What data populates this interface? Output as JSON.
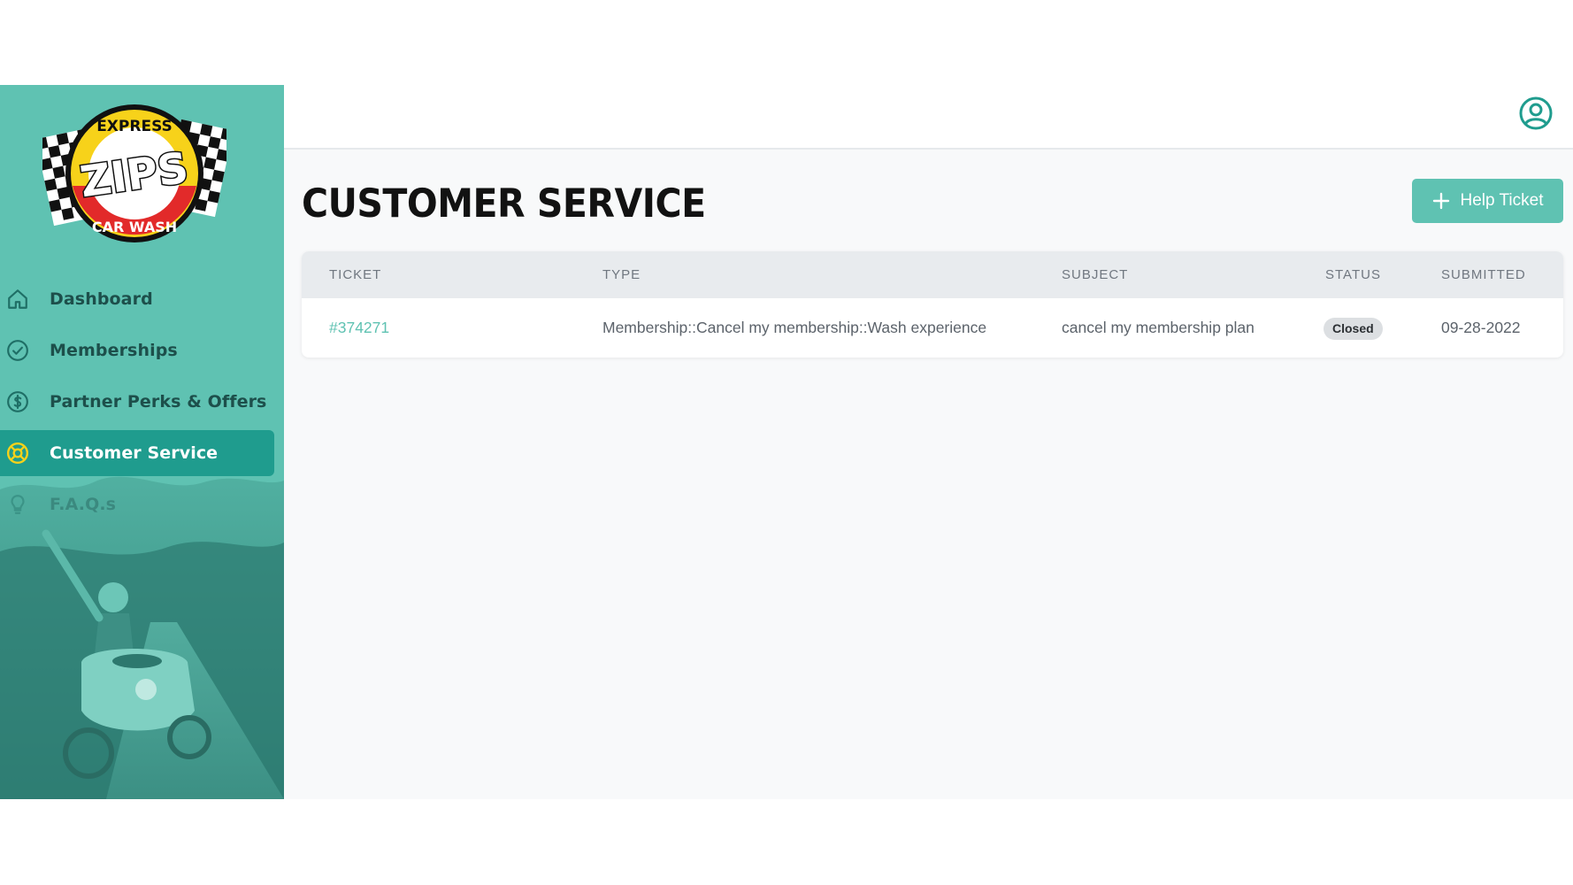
{
  "brand": {
    "logo_alt": "Zips Express Car Wash",
    "logo_text_top": "EXPRESS",
    "logo_text_main": "ZIPS",
    "logo_text_bottom": "CAR WASH",
    "accent_color": "#5fc2b2",
    "active_color": "#1f9c8e"
  },
  "sidebar": {
    "items": [
      {
        "label": "Dashboard",
        "icon": "home-icon",
        "active": false
      },
      {
        "label": "Memberships",
        "icon": "check-circle-icon",
        "active": false
      },
      {
        "label": "Partner Perks & Offers",
        "icon": "dollar-circle-icon",
        "active": false
      },
      {
        "label": "Customer Service",
        "icon": "lifebuoy-icon",
        "active": true
      },
      {
        "label": "F.A.Q.s",
        "icon": "lightbulb-icon",
        "active": false
      }
    ]
  },
  "header": {
    "profile_icon": "user-circle-icon"
  },
  "page": {
    "title": "CUSTOMER SERVICE",
    "help_button_label": "Help Ticket",
    "help_button_icon": "plus-icon"
  },
  "table": {
    "columns": [
      "TICKET",
      "TYPE",
      "SUBJECT",
      "STATUS",
      "SUBMITTED"
    ],
    "rows": [
      {
        "ticket": "#374271",
        "type": "Membership::Cancel my membership::Wash experience",
        "subject": "cancel my membership plan",
        "status": "Closed",
        "submitted": "09-28-2022"
      }
    ]
  }
}
